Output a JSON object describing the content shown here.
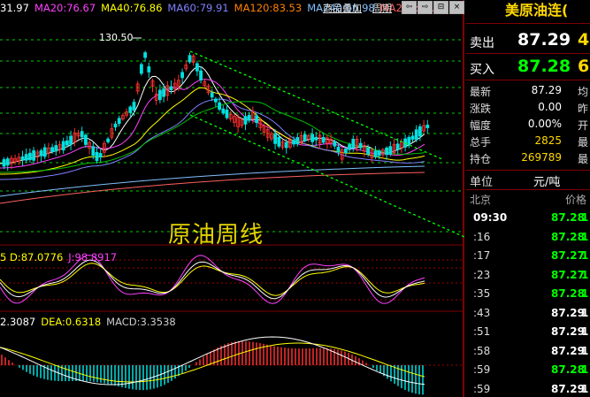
{
  "chart": {
    "ma_legend": [
      {
        "label": "31.97",
        "color": "#ffffff"
      },
      {
        "label": "MA20:76.67",
        "color": "#ff40ff"
      },
      {
        "label": "MA40:76.86",
        "color": "#ffff00"
      },
      {
        "label": "MA60:79.91",
        "color": "#8080ff"
      },
      {
        "label": "MA120:83.53",
        "color": "#ff8000"
      },
      {
        "label": "MA240:66.98",
        "color": "#80c0ff"
      },
      {
        "label": "MA250:66.34",
        "color": "#ff6060"
      }
    ],
    "high_label": "130.50",
    "title": "原油周线",
    "kdj_legend": [
      {
        "label": "5 D:87.0776",
        "color": "#ffff00"
      },
      {
        "label": "J:98.8917",
        "color": "#ff40ff"
      }
    ],
    "macd_legend": [
      {
        "label": "2.3087",
        "color": "#ffffff"
      },
      {
        "label": "DEA:0.6318",
        "color": "#ffff00"
      },
      {
        "label": "MACD:3.3538",
        "color": "#cccccc"
      }
    ],
    "colors": {
      "up": "#ff3030",
      "down": "#00e0e0",
      "grid": "#00d000",
      "trend": "#00ff00"
    }
  },
  "toolbar": {
    "overlay_label": "商品叠加",
    "period_label": "周期",
    "buttons": [
      "⇦",
      "⇨",
      "⊟",
      "×"
    ]
  },
  "panel": {
    "name": "美原油连(",
    "sell_label": "卖出",
    "sell_price": "87.29",
    "sell_vol": "4",
    "buy_label": "买入",
    "buy_price": "87.28",
    "buy_vol": "6",
    "stats": [
      {
        "label": "最新",
        "value": "87.29",
        "color": "#ffffff",
        "ext": "均"
      },
      {
        "label": "涨跌",
        "value": "0.00",
        "color": "#ffffff",
        "ext": "昨"
      },
      {
        "label": "幅度",
        "value": "0.00%",
        "color": "#ffffff",
        "ext": "开"
      },
      {
        "label": "总手",
        "value": "2825",
        "color": "#ffd800",
        "ext": "最"
      },
      {
        "label": "持仓",
        "value": "269789",
        "color": "#ffd800",
        "ext": "最"
      }
    ],
    "unit_label": "单位",
    "unit_value": "元/吨",
    "location": "北京",
    "price_header": "价格",
    "ticks": [
      {
        "time": "09:30",
        "price": "87.28",
        "color": "#00ff00",
        "tail": "1"
      },
      {
        "time": ":16",
        "price": "87.28",
        "color": "#00ff00",
        "tail": "1"
      },
      {
        "time": ":17",
        "price": "87.27",
        "color": "#00ff00",
        "tail": "1"
      },
      {
        "time": ":23",
        "price": "87.27",
        "color": "#00ff00",
        "tail": "1"
      },
      {
        "time": ":35",
        "price": "87.28",
        "color": "#00ff00",
        "tail": "1"
      },
      {
        "time": ":43",
        "price": "87.29",
        "color": "#ffffff",
        "tail": "1"
      },
      {
        "time": ":51",
        "price": "87.29",
        "color": "#ffffff",
        "tail": "1"
      },
      {
        "time": ":58",
        "price": "87.29",
        "color": "#ffffff",
        "tail": "1"
      },
      {
        "time": ":59",
        "price": "87.28",
        "color": "#00ff00",
        "tail": "1"
      },
      {
        "time": ":59",
        "price": "87.29",
        "color": "#ffffff",
        "tail": "1"
      }
    ]
  }
}
